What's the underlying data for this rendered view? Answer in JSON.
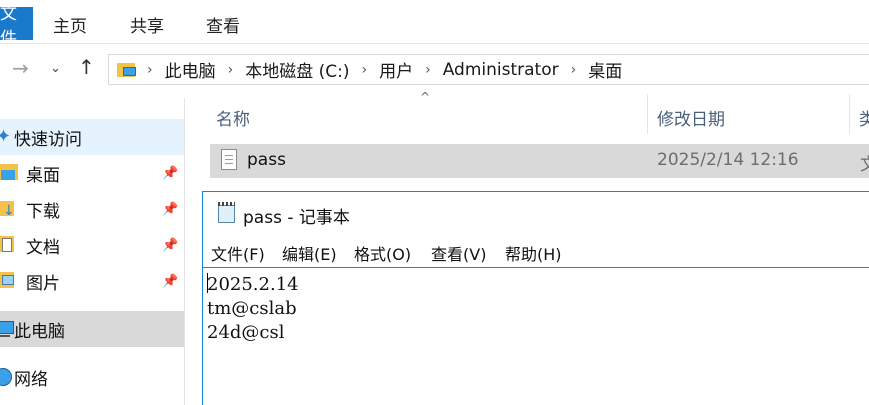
{
  "ribbon": {
    "tabs": {
      "file": "文件",
      "home": "主页",
      "share": "共享",
      "view": "查看"
    }
  },
  "address": {
    "breadcrumbs": [
      "此电脑",
      "本地磁盘 (C:)",
      "用户",
      "Administrator",
      "桌面"
    ]
  },
  "sidebar": {
    "items": [
      {
        "label": "快速访问"
      },
      {
        "label": "桌面",
        "pinned": true
      },
      {
        "label": "下载",
        "pinned": true
      },
      {
        "label": "文档",
        "pinned": true
      },
      {
        "label": "图片",
        "pinned": true
      },
      {
        "label": "此电脑"
      },
      {
        "label": "网络"
      }
    ]
  },
  "file_list": {
    "columns": {
      "name": "名称",
      "date": "修改日期",
      "type": "类"
    },
    "rows": [
      {
        "name": "pass",
        "date": "2025/2/14 12:16",
        "type": "文"
      }
    ]
  },
  "notepad": {
    "title": "pass - 记事本",
    "menu": {
      "file": "文件(F)",
      "edit": "编辑(E)",
      "format": "格式(O)",
      "view": "查看(V)",
      "help": "帮助(H)"
    },
    "content": "2025.2.14\ntm@cslab\n24d@csl"
  },
  "colors": {
    "accent": "#1979ca",
    "selection": "#d9d9d9",
    "window_border": "#1883d7"
  }
}
